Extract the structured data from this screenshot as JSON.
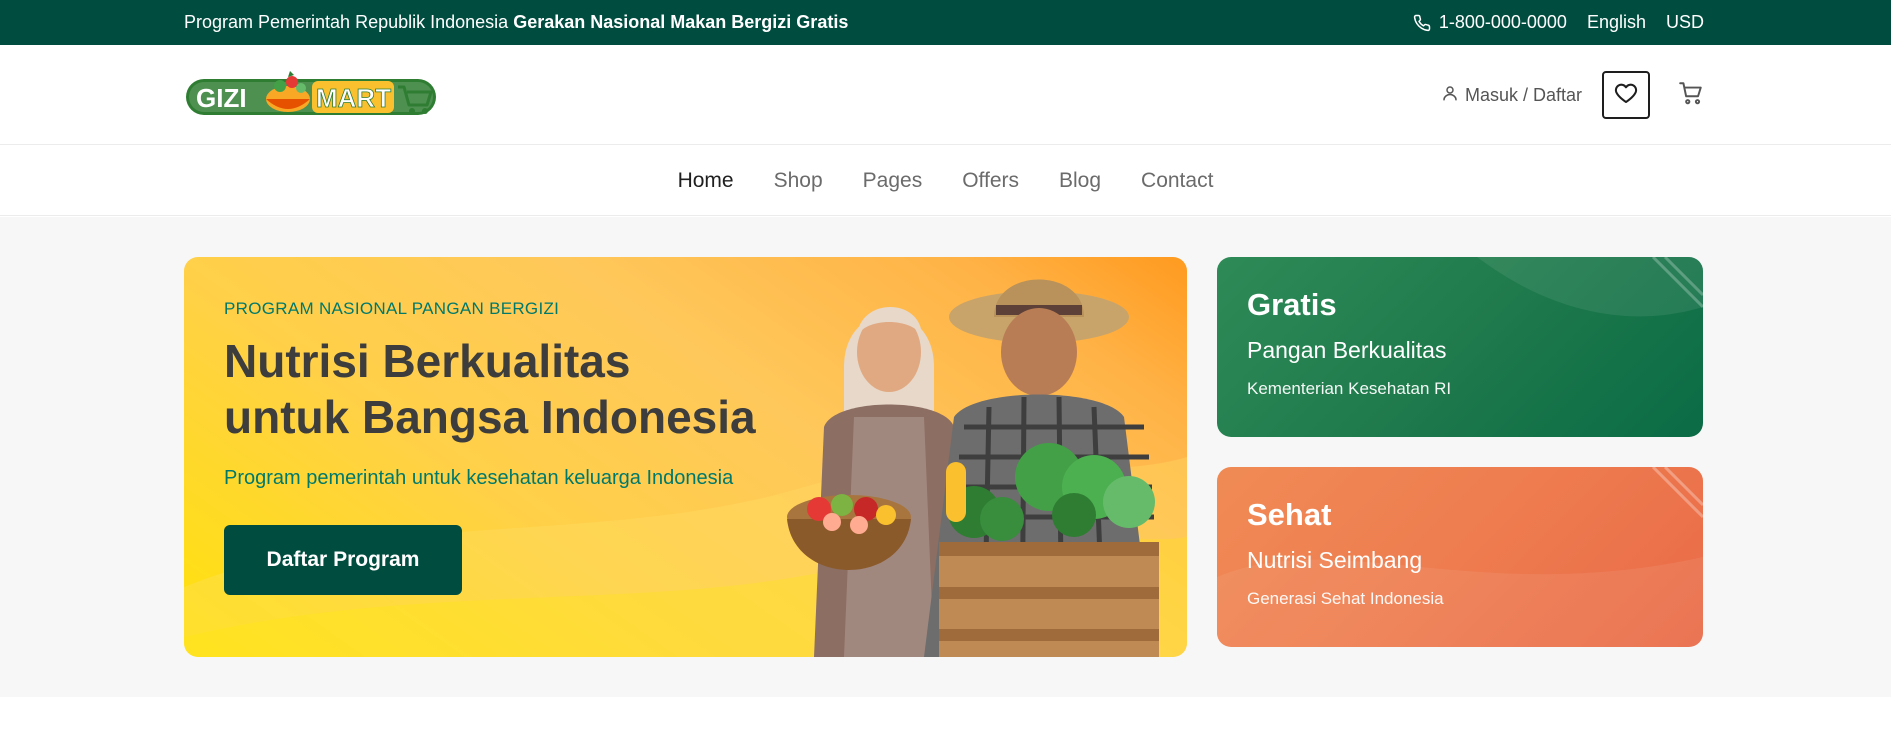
{
  "topbar": {
    "program_text": "Program Pemerintah Republik Indonesia",
    "program_strong": "Gerakan Nasional Makan Bergizi Gratis",
    "phone": "1-800-000-0000",
    "language": "English",
    "currency": "USD"
  },
  "header": {
    "logo_left": "GIZI",
    "logo_right": "MART",
    "login_label": "Masuk / Daftar",
    "icons": [
      "user-icon",
      "heart-icon",
      "cart-icon"
    ]
  },
  "nav": {
    "items": [
      {
        "label": "Home",
        "active": true
      },
      {
        "label": "Shop",
        "active": false
      },
      {
        "label": "Pages",
        "active": false
      },
      {
        "label": "Offers",
        "active": false
      },
      {
        "label": "Blog",
        "active": false
      },
      {
        "label": "Contact",
        "active": false
      }
    ]
  },
  "hero": {
    "eyebrow": "PROGRAM NASIONAL PANGAN BERGIZI",
    "title_line1": "Nutrisi Berkualitas",
    "title_line2": "untuk Bangsa Indonesia",
    "subtitle": "Program pemerintah untuk kesehatan keluarga Indonesia",
    "cta_label": "Daftar Program"
  },
  "cards": [
    {
      "title": "Gratis",
      "subtitle": "Pangan Berkualitas",
      "note": "Kementerian Kesehatan RI"
    },
    {
      "title": "Sehat",
      "subtitle": "Nutrisi Seimbang",
      "note": "Generasi Sehat Indonesia"
    }
  ],
  "colors": {
    "brand_dark": "#004d40",
    "accent_teal": "#00796b",
    "hero_yellow": "#ffd048",
    "card_green": "#1f7a4c",
    "card_orange": "#ee7c4f"
  }
}
